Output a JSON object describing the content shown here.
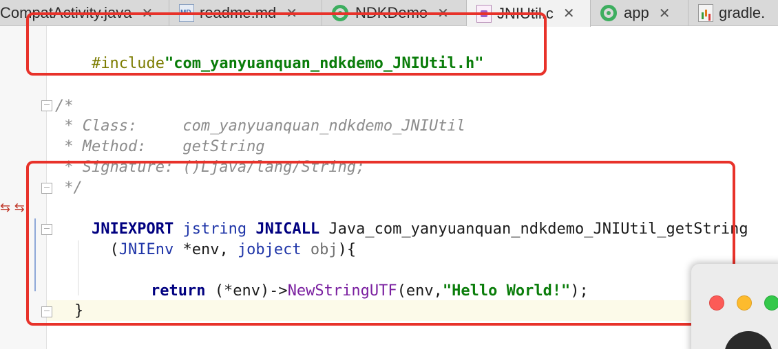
{
  "tabs": [
    {
      "label": "CompatActivity.java",
      "icon": "java-file-icon",
      "closable": true
    },
    {
      "label": "readme.md",
      "icon": "markdown-file-icon",
      "closable": true
    },
    {
      "label": "NDKDemo",
      "icon": "android-module-icon",
      "closable": true
    },
    {
      "label": "JNIUtil.c",
      "icon": "c-file-icon",
      "closable": true,
      "active": true
    },
    {
      "label": "app",
      "icon": "android-module-icon",
      "closable": true
    },
    {
      "label": "gradle.",
      "icon": "gradle-file-icon",
      "closable": false
    }
  ],
  "close_glyph": "✕",
  "code": {
    "include_directive": "#include",
    "include_file": "\"com_yanyuanquan_ndkdemo_JNIUtil.h\"",
    "comment_open": "/*",
    "comment_class": " * Class:     com_yanyuanquan_ndkdemo_JNIUtil",
    "comment_method": " * Method:    getString",
    "comment_signature": " * Signature: ()Ljava/lang/String;",
    "comment_close": " */",
    "jniexport": "JNIEXPORT",
    "jstring": "jstring",
    "jnicall": "JNICALL",
    "function_name": "Java_com_yanyuanquan_ndkdemo_JNIUtil_getString",
    "params_open": "  (",
    "jnienv": "JNIEnv",
    "env_param": " *env, ",
    "jobject": "jobject",
    "obj_param": " obj",
    "params_close": "){",
    "return_kw": "return",
    "return_expr_start": " (*env)->",
    "new_string_call": "NewStringUTF",
    "return_args_start": "(env,",
    "hello_string": "\"Hello World!\"",
    "return_args_end": ");",
    "closing_brace": "}"
  },
  "colors": {
    "highlight_box": "#e8322a",
    "string": "#0a7d0a",
    "keyword": "#000080",
    "macro": "#7c7c00"
  }
}
